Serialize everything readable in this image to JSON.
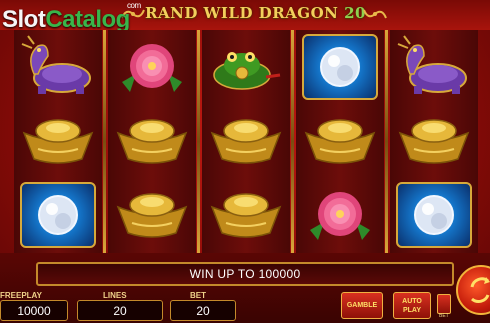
{
  "watermark": {
    "slot": "Slot",
    "catalog": "Catalog",
    "com": "com"
  },
  "game": {
    "title_text": "RAND WILD DRAGON ",
    "title_number": "20"
  },
  "reels": [
    [
      "dragon-turtle",
      "gold-ingot",
      "pearl"
    ],
    [
      "peony-flower",
      "gold-ingot",
      "gold-ingot"
    ],
    [
      "money-toad",
      "gold-ingot",
      "gold-ingot"
    ],
    [
      "pearl",
      "gold-ingot",
      "peony-flower"
    ],
    [
      "dragon-turtle",
      "gold-ingot",
      "pearl"
    ]
  ],
  "win_message": "WIN UP TO 100000",
  "stats": {
    "freeplay_label": "FREEPLAY",
    "freeplay_value": "10000",
    "lines_label": "LINES",
    "lines_value": "20",
    "bet_label": "BET",
    "bet_value": "20"
  },
  "buttons": {
    "gamble": "GAMBLE",
    "auto_line1": "AUTO",
    "auto_line2": "PLAY",
    "bet_side_label": "BET"
  },
  "colors": {
    "gold": "#d7a93b",
    "background_red": "#a8140c",
    "title_gold": "#f3cf5c",
    "logo_green": "#39b54a"
  }
}
